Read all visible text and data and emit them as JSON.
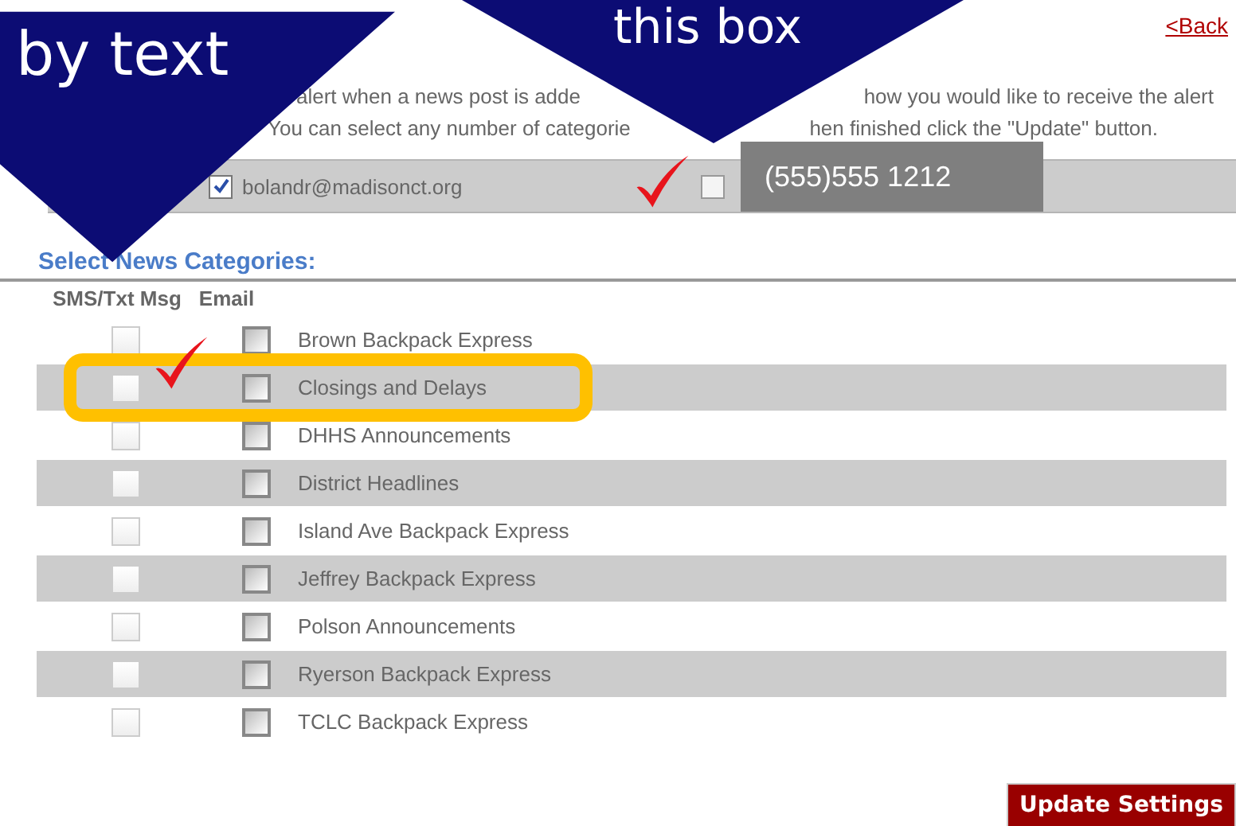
{
  "callouts": [
    {
      "text": "by text"
    },
    {
      "text": "this box"
    }
  ],
  "back_link": "<Back",
  "instructions": [
    {
      "left": "alert when a news post is adde",
      "right": "how you would like to receive the alert"
    },
    {
      "left": "You can select any number of categorie",
      "right": "hen finished click the \"Update\" button."
    }
  ],
  "contact": {
    "email_checked": true,
    "email": "bolandr@madisonct.org",
    "phone_checked": false,
    "phone_label": "(555)555 1212"
  },
  "section_title": "Select News Categories:",
  "columns": [
    "SMS/Txt Msg",
    "Email"
  ],
  "categories": [
    {
      "name": "Brown Backpack Express",
      "sms": false,
      "email": false,
      "highlighted": false
    },
    {
      "name": "Closings and Delays",
      "sms": false,
      "email": false,
      "highlighted": true
    },
    {
      "name": "DHHS Announcements",
      "sms": false,
      "email": false,
      "highlighted": false
    },
    {
      "name": "District Headlines",
      "sms": false,
      "email": false,
      "highlighted": false
    },
    {
      "name": "Island Ave Backpack Express",
      "sms": false,
      "email": false,
      "highlighted": false
    },
    {
      "name": "Jeffrey Backpack Express",
      "sms": false,
      "email": false,
      "highlighted": false
    },
    {
      "name": "Polson Announcements",
      "sms": false,
      "email": false,
      "highlighted": false
    },
    {
      "name": "Ryerson Backpack Express",
      "sms": false,
      "email": false,
      "highlighted": false
    },
    {
      "name": "TCLC Backpack Express",
      "sms": false,
      "email": false,
      "highlighted": false
    }
  ],
  "update_button": "Update Settings"
}
